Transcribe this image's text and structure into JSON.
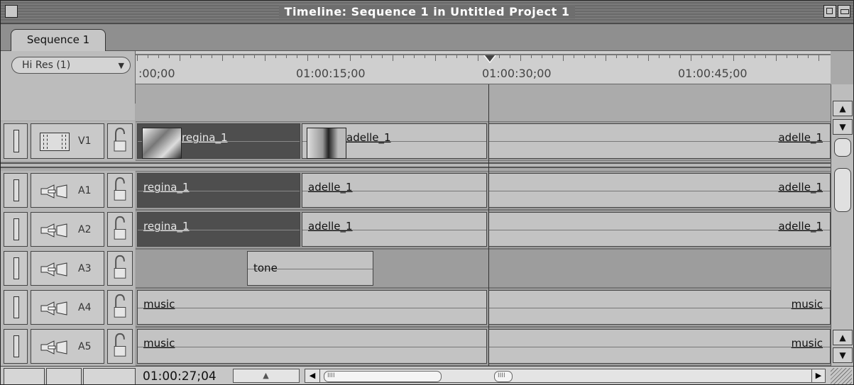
{
  "window": {
    "title": "Timeline: Sequence 1 in Untitled Project 1"
  },
  "tabs": [
    {
      "label": "Sequence 1",
      "active": true
    }
  ],
  "rt_menu": {
    "selected": "Hi Res  (1)"
  },
  "ruler": {
    "labels": [
      ":00;00",
      "01:00:15;00",
      "01:00:30;00",
      "01:00:45;00"
    ]
  },
  "tracks": [
    {
      "id": "V1",
      "label": "V1",
      "type": "video",
      "clips": [
        {
          "name": "regina_1",
          "dark": true,
          "thumb": true
        },
        {
          "name": "adelle_1",
          "dark": false,
          "thumb": true
        },
        {
          "name": "adelle_1",
          "dark": false,
          "thumb": false
        }
      ]
    },
    {
      "id": "A1",
      "label": "A1",
      "type": "audio",
      "clips": [
        {
          "name": "regina_1",
          "dark": true
        },
        {
          "name": "adelle_1",
          "dark": false
        },
        {
          "name": "adelle_1",
          "dark": false
        }
      ]
    },
    {
      "id": "A2",
      "label": "A2",
      "type": "audio",
      "clips": [
        {
          "name": "regina_1",
          "dark": true
        },
        {
          "name": "adelle_1",
          "dark": false
        },
        {
          "name": "adelle_1",
          "dark": false
        }
      ]
    },
    {
      "id": "A3",
      "label": "A3",
      "type": "audio",
      "clips": [
        {
          "name": "tone",
          "dark": false
        }
      ]
    },
    {
      "id": "A4",
      "label": "A4",
      "type": "audio",
      "clips": [
        {
          "name": "music",
          "dark": false
        },
        {
          "name": "music",
          "dark": false
        }
      ]
    },
    {
      "id": "A5",
      "label": "A5",
      "type": "audio",
      "clips": [
        {
          "name": "music",
          "dark": false
        },
        {
          "name": "music",
          "dark": false
        }
      ]
    }
  ],
  "bottom": {
    "timecode": "01:00:27;04"
  }
}
